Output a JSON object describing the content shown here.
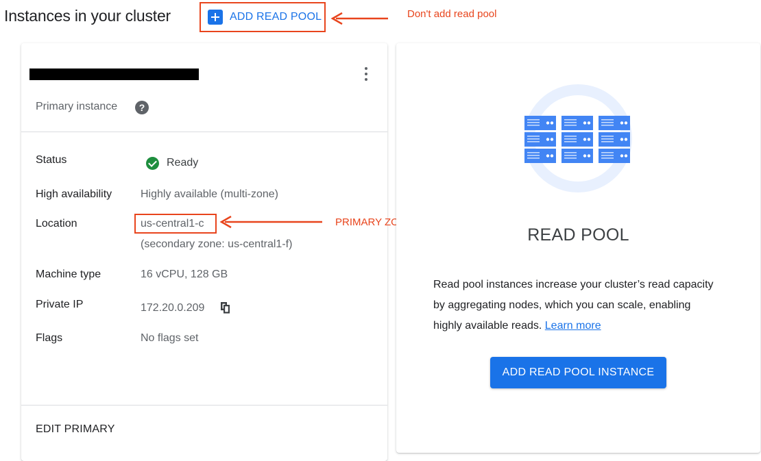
{
  "header": {
    "title": "Instances in your cluster",
    "add_read_pool_label": "ADD READ POOL",
    "annotation_note": "Don't add read pool"
  },
  "primary_card": {
    "subtitle": "Primary instance",
    "help_glyph": "?",
    "rows": {
      "status": {
        "label": "Status",
        "value": "Ready"
      },
      "high_availability": {
        "label": "High availability",
        "value": "Highly available (multi-zone)"
      },
      "location": {
        "label": "Location",
        "value": "us-central1-c",
        "secondary": "(secondary zone: us-central1-f)"
      },
      "machine_type": {
        "label": "Machine type",
        "value": "16 vCPU, 128 GB"
      },
      "private_ip": {
        "label": "Private IP",
        "value": "172.20.0.209"
      },
      "flags": {
        "label": "Flags",
        "value": "No flags set"
      }
    },
    "location_annotation": "PRIMARY ZONE",
    "edit_label": "EDIT PRIMARY"
  },
  "read_pool_card": {
    "title": "READ POOL",
    "description": "Read pool instances increase your cluster’s read capacity by aggregating nodes, which you can scale, enabling highly available reads.",
    "learn_more": "Learn more",
    "add_button": "ADD READ POOL INSTANCE"
  },
  "icons": {
    "plus": "plus-icon",
    "more": "more-vert-icon",
    "help": "help-icon",
    "status": "check-circle-icon",
    "copy": "copy-icon",
    "illustration": "server-rack-illustration"
  },
  "colors": {
    "accent": "#1a73e8",
    "annotation": "#e8441c",
    "ready": "#1e8e3e",
    "secondary_text": "#5f6368"
  }
}
